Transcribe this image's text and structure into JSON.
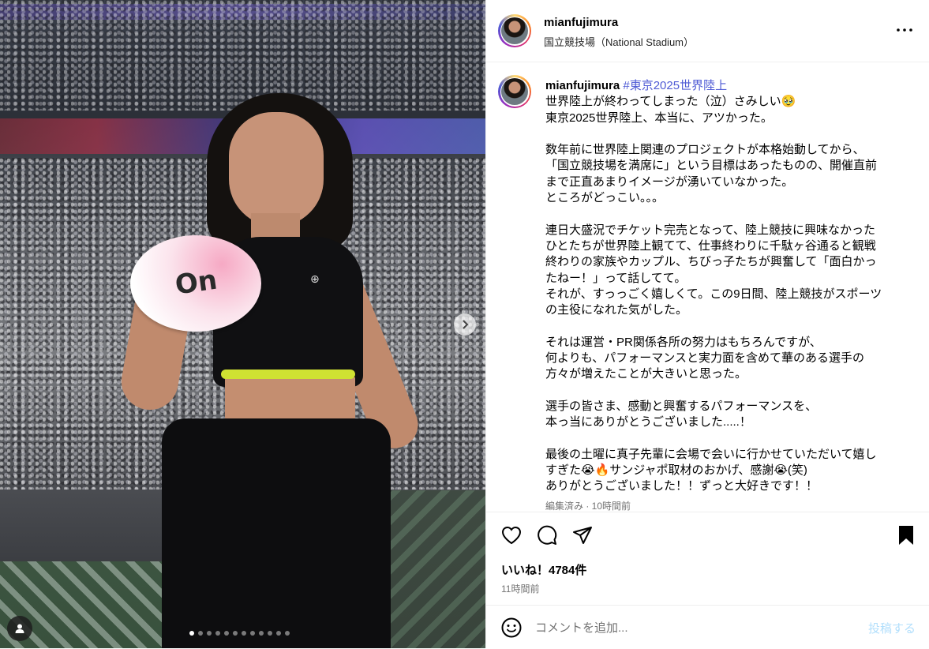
{
  "post": {
    "username": "mianfujimura",
    "location": "国立競技場（National Stadium）"
  },
  "caption": {
    "username": "mianfujimura",
    "hashtag": "#東京2025世界陸上",
    "text": "世界陸上が終わってしまった（泣）さみしい🥹\n東京2025世界陸上、本当に、アツかった。\n\n数年前に世界陸上関連のプロジェクトが本格始動してから、\n「国立競技場を満席に」という目標はあったものの、開催直前\nまで正直あまりイメージが湧いていなかった。\nところがどっこい。。。\n\n連日大盛況でチケット完売となって、陸上競技に興味なかった\nひとたちが世界陸上観てて、仕事終わりに千駄ヶ谷通ると観戦\n終わりの家族やカップル、ちびっ子たちが興奮して「面白かっ\nたねー！」って話してて。\nそれが、すっっごく嬉しくて。この9日間、陸上競技がスポーツ\nの主役になれた気がした。\n\nそれは運営・PR関係各所の努力はもちろんですが、\n何よりも、パフォーマンスと実力面を含めて華のある選手の\n方々が増えたことが大きいと思った。\n\n選手の皆さま、感動と興奮するパフォーマンスを、\n本っ当にありがとうございました.....！\n\n最後の土曜に真子先輩に会場で会いに行かせていただいて嬉し\nすぎた😭🔥サンジャポ取材のおかげ、感謝😭(笑)\nありがとうございました！！ずっと大好きです！！",
    "edited": "編集済み · 10時間前"
  },
  "stats": {
    "likes": "いいね！4784件",
    "time": "11時間前"
  },
  "comment": {
    "placeholder": "コメントを追加...",
    "post_label": "投稿する"
  },
  "media": {
    "fan_logo": "On",
    "carousel_count": 12,
    "carousel_active": 0
  },
  "colors": {
    "hashtag": "#4f5bd5",
    "post_button_disabled": "#b2dffc",
    "secondary_text": "#737373"
  },
  "icons": [
    "more-icon",
    "heart-icon",
    "comment-icon",
    "share-icon",
    "bookmark-icon",
    "emoji-icon",
    "chevron-right-icon",
    "user-tag-icon"
  ]
}
